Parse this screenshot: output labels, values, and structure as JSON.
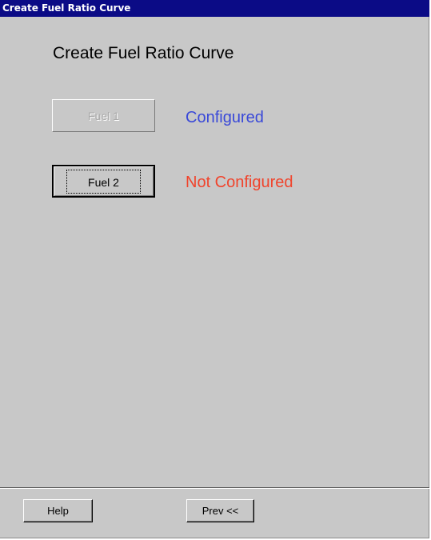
{
  "window": {
    "title": "Create Fuel Ratio Curve"
  },
  "main": {
    "heading": "Create Fuel Ratio Curve",
    "fuels": [
      {
        "button_label": "Fuel 1",
        "status": "Configured",
        "status_color": "#3a49d8",
        "enabled": false
      },
      {
        "button_label": "Fuel 2",
        "status": "Not Configured",
        "status_color": "#f0442c",
        "enabled": true
      }
    ]
  },
  "footer": {
    "help_label": "Help",
    "prev_label": "Prev <<"
  },
  "colors": {
    "titlebar": "#0b0b86",
    "background": "#c8c8c8"
  }
}
